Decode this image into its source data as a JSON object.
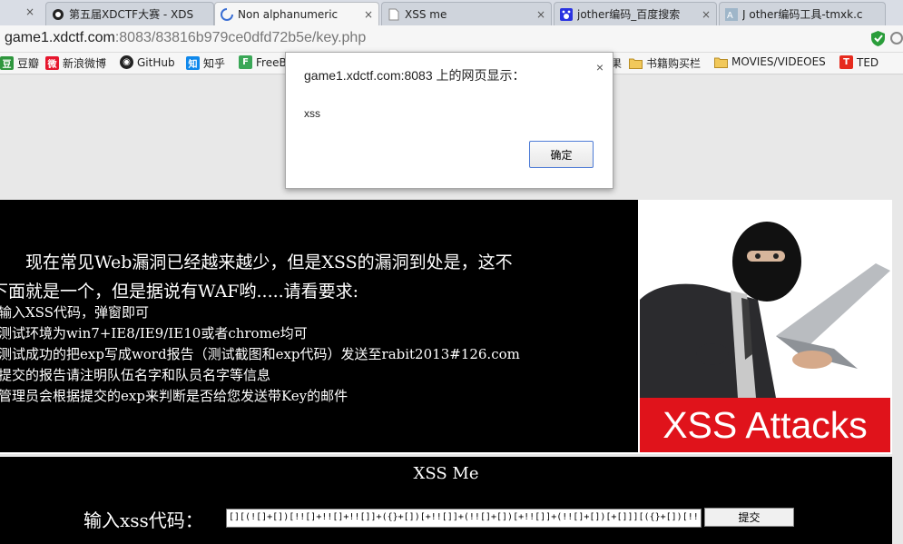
{
  "browser": {
    "tabs": [
      {
        "title": "第五届XDCTF大赛 - XDS",
        "icon": "ctf-icon"
      },
      {
        "title": "Non alphanumeric",
        "icon": "loading-spinner-icon",
        "active": true
      },
      {
        "title": "XSS me",
        "icon": "page-icon"
      },
      {
        "title": "jother编码_百度搜索",
        "icon": "baidu-paw-icon"
      },
      {
        "title": "J other编码工具-tmxk.c",
        "icon": "tmxk-icon"
      }
    ],
    "close_glyph": "×",
    "url_host": "game1.xdctf.com",
    "url_rest": ":8083/83816b979ce0dfd72b5e/key.php"
  },
  "bookmarks": [
    {
      "label": "豆瓣",
      "icon": "douban-icon",
      "color": "#2e963d",
      "glyph": "豆"
    },
    {
      "label": "新浪微博",
      "icon": "weibo-icon",
      "color": "#e6162d",
      "glyph": "微"
    },
    {
      "label": "GitHub",
      "icon": "github-icon",
      "color": "#222222",
      "glyph": "◉"
    },
    {
      "label": "知乎",
      "icon": "zhihu-icon",
      "color": "#0f88eb",
      "glyph": "知"
    },
    {
      "label": "FreeB",
      "icon": "freebuf-icon",
      "color": "#3aa757",
      "glyph": "F"
    },
    {
      "label": "果",
      "icon": "",
      "color": "",
      "glyph": ""
    },
    {
      "label": "书籍购买栏",
      "icon": "folder-icon",
      "color": "#e3b23c",
      "glyph": ""
    },
    {
      "label": "MOVIES/VIDEOES",
      "icon": "folder-icon",
      "color": "#e3b23c",
      "glyph": ""
    },
    {
      "label": "TED",
      "icon": "ted-icon",
      "color": "#e62b1e",
      "glyph": "T"
    }
  ],
  "page": {
    "intro_line1": "现在常见Web漏洞已经越来越少，但是XSS的漏洞到处是，这不",
    "intro_line2": "下面就是一个，但是据说有WAF哟.....请看要求:",
    "rules": [
      "输入XSS代码，弹窗即可",
      "测试环境为win7+IE8/IE9/IE10或者chrome均可",
      "测试成功的把exp写成word报告（测试截图和exp代码）发送至rabit2013#126.com",
      "提交的报告请注明队伍名字和队员名字等信息",
      "管理员会根据提交的exp来判断是否给您发送带Key的邮件"
    ],
    "banner": "XSS Attacks",
    "form_title": "XSS Me",
    "form_label": "输入xss代码：",
    "input_value": "[][(![]+[])[!![]+!![]+!![]]+({}+[])[+!![]]+(!![]+[])[+!![]]+(!![]+[])[+[]]][({}+[])[!![]+!![]+!![]+!![]+!![]]+({}+[])",
    "submit_label": "提交"
  },
  "dialog": {
    "title": "game1.xdctf.com:8083 上的网页显示：",
    "message": "xss",
    "ok_label": "确定",
    "close_glyph": "×"
  }
}
